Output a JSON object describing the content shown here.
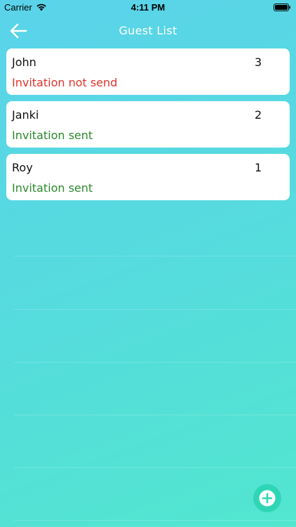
{
  "status_bar": {
    "carrier": "Carrier",
    "time": "4:11 PM"
  },
  "nav": {
    "title": "Guest List",
    "back_icon": "arrow-left-icon"
  },
  "guests": [
    {
      "name": "John",
      "count": "3",
      "status": "Invitation not send",
      "status_color": "#e0332b"
    },
    {
      "name": "Janki",
      "count": "2",
      "status": "Invitation sent",
      "status_color": "#2c8a2c"
    },
    {
      "name": "Roy",
      "count": "1",
      "status": "Invitation sent",
      "status_color": "#2c8a2c"
    }
  ],
  "fab": {
    "icon": "plus-circle-icon"
  },
  "colors": {
    "background_top": "#5ad3ea",
    "background_bottom": "#52e6cf",
    "fab": "#2fd6b6"
  }
}
